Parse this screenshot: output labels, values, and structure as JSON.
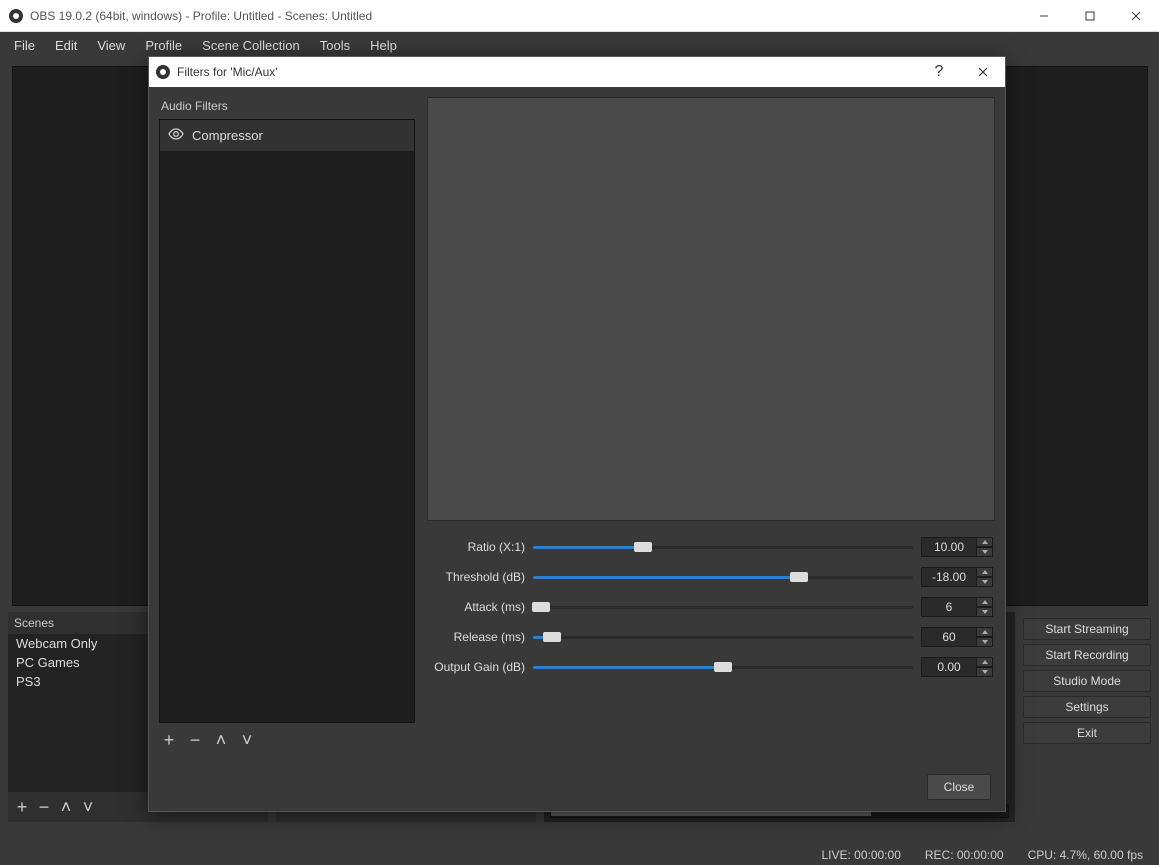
{
  "window": {
    "title": "OBS 19.0.2 (64bit, windows) - Profile: Untitled - Scenes: Untitled"
  },
  "menubar": {
    "items": [
      "File",
      "Edit",
      "View",
      "Profile",
      "Scene Collection",
      "Tools",
      "Help"
    ]
  },
  "scenes": {
    "header": "Scenes",
    "items": [
      "Webcam Only",
      "PC Games",
      "PS3"
    ]
  },
  "buttons": {
    "start_streaming": "Start Streaming",
    "start_recording": "Start Recording",
    "studio_mode": "Studio Mode",
    "settings": "Settings",
    "exit": "Exit"
  },
  "statusbar": {
    "live": "LIVE: 00:00:00",
    "rec": "REC: 00:00:00",
    "cpu": "CPU: 4.7%, 60.00 fps"
  },
  "dialog": {
    "title": "Filters for 'Mic/Aux'",
    "audio_filters_label": "Audio Filters",
    "filters": [
      {
        "name": "Compressor"
      }
    ],
    "close_label": "Close",
    "props": {
      "ratio": {
        "label": "Ratio (X:1)",
        "value": "10.00",
        "fill_pct": 29
      },
      "threshold": {
        "label": "Threshold (dB)",
        "value": "-18.00",
        "fill_pct": 70
      },
      "attack": {
        "label": "Attack (ms)",
        "value": "6",
        "fill_pct": 2
      },
      "release": {
        "label": "Release (ms)",
        "value": "60",
        "fill_pct": 5
      },
      "outputgain": {
        "label": "Output Gain (dB)",
        "value": "0.00",
        "fill_pct": 50
      }
    }
  }
}
